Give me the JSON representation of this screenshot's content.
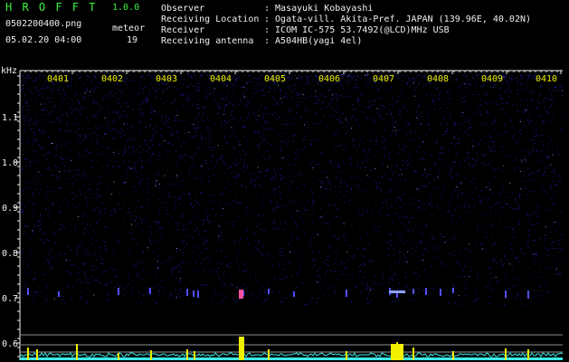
{
  "header": {
    "app_letters": "H R O F F T",
    "version": "1.0.0",
    "filename": "0502200400.png",
    "datetime": "05.02.20 04:00",
    "meteor_label": "meteor",
    "meteor_count": "19"
  },
  "info": {
    "labels": [
      "Observer",
      "Receiving Location",
      "Receiver",
      "Receiving antenna"
    ],
    "values": [
      ": Masayuki Kobayashi",
      ": Ogata-vill. Akita-Pref. JAPAN (139.96E, 40.02N)",
      ": ICOM IC-575 53.7492(@LCD)MHz USB",
      ": A504HB(yagi 4el)"
    ]
  },
  "chart_data": {
    "type": "heatmap",
    "ylabel": "kHz",
    "y_ticks": [
      "1.1",
      "1.0",
      "0.9",
      "0.8",
      "0.7",
      "0.6"
    ],
    "time_labels": [
      "0401",
      "0402",
      "0403",
      "0404",
      "0405",
      "0406",
      "0407",
      "0408",
      "0409",
      "0410"
    ],
    "colors": {
      "background": "#000000",
      "noise": "#2020c0",
      "axis": "#f0f0f0",
      "labels": "#f0f000",
      "meteor_line": "#f0f000",
      "baseline": "#3ce8e8"
    }
  }
}
